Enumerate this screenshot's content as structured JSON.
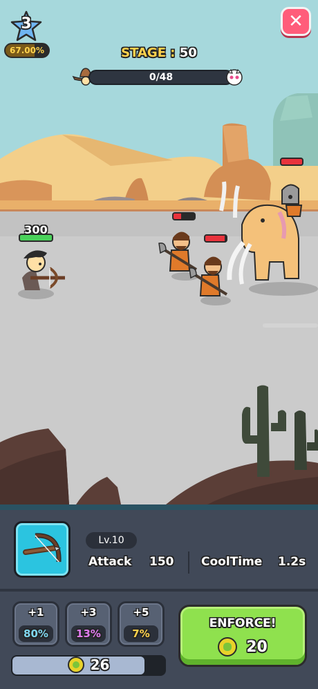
{
  "player": {
    "level": "3",
    "exp_percent": "67.00%",
    "exp_fraction": 0.67
  },
  "stage": {
    "label": "STAGE",
    "separator": ":",
    "number": "50",
    "progress_text": "0/48",
    "progress_fraction": 0
  },
  "hero": {
    "hp_text": "300"
  },
  "weapon": {
    "level": "Lv.10",
    "attack_label": "Attack",
    "attack_value": "150",
    "cooltime_label": "CoolTime",
    "cooltime_value": "1.2s"
  },
  "upgrades": [
    {
      "label": "+1",
      "percent": "80%",
      "color": "#7fd6f0"
    },
    {
      "label": "+3",
      "percent": "13%",
      "color": "#e07cf0"
    },
    {
      "label": "+5",
      "percent": "7%",
      "color": "#ffd24d"
    }
  ],
  "gold": {
    "amount": "26",
    "fill_fraction": 0.87
  },
  "enforce": {
    "label": "ENFORCE!",
    "cost": "20"
  },
  "close_icon": "close-icon",
  "colors": {
    "accent_green": "#8fe14e",
    "hp_green": "#49d15a",
    "hp_red": "#e8323c",
    "stage_yellow": "#ffd24d"
  }
}
